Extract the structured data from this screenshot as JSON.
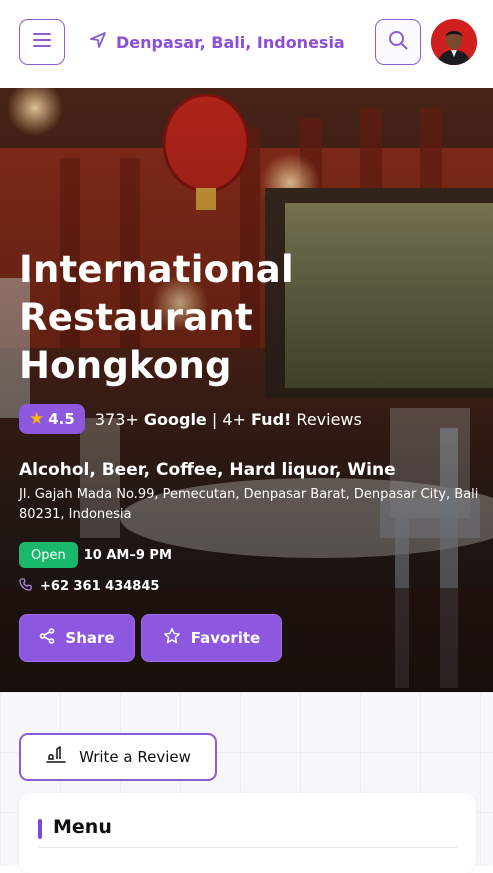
{
  "header": {
    "menu_icon": "hamburger-icon",
    "location_icon": "navigation-arrow-icon",
    "location": "Denpasar, Bali, Indonesia",
    "search_icon": "search-icon",
    "avatar_icon": "user-avatar"
  },
  "restaurant": {
    "name": "International Restaurant Hongkong",
    "rating": "4.5",
    "google_count": "373+",
    "google_label": "Google",
    "separator": "|",
    "fud_count": "4+",
    "fud_label": "Fud!",
    "reviews_label": "Reviews",
    "cuisines": "Alcohol, Beer, Coffee, Hard liquor, Wine",
    "address": "Jl. Gajah Mada No.99, Pemecutan, Denpasar Barat, Denpasar City, Bali 80231, Indonesia",
    "status": "Open",
    "hours": "10 AM–9 PM",
    "phone": "+62 361 434845"
  },
  "actions": {
    "share_label": "Share",
    "favorite_label": "Favorite",
    "review_label": "Write a Review"
  },
  "sections": {
    "menu_title": "Menu"
  },
  "colors": {
    "accent": "#8e57e0",
    "open": "#19b86b",
    "star": "#f5b800"
  }
}
